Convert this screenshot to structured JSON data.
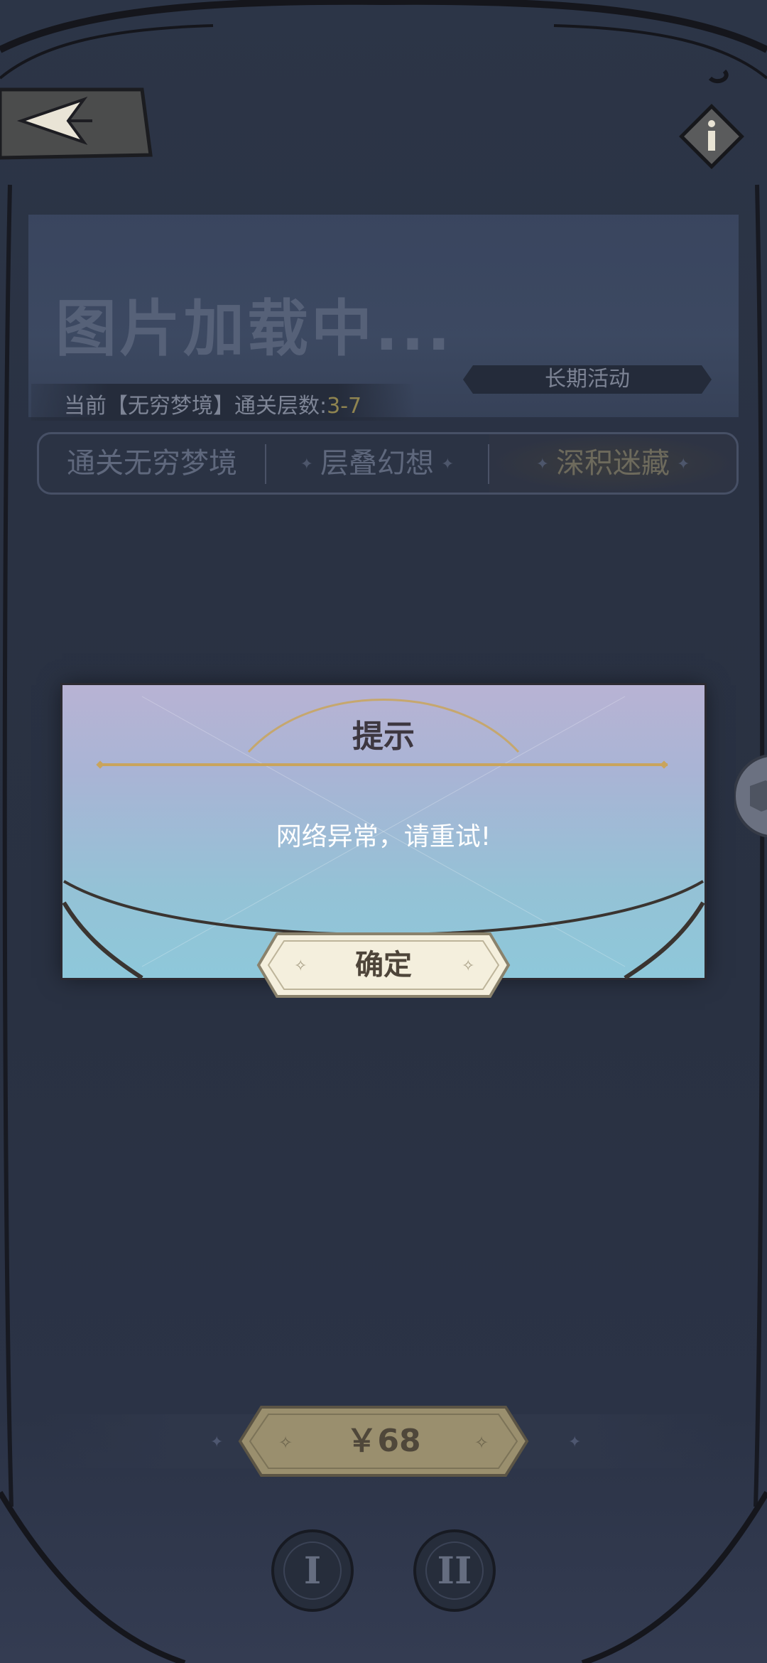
{
  "banner": {
    "title": "图片加载中...",
    "tag": "长期活动",
    "progress_label": "当前【无穷梦境】通关层数:",
    "progress_value": "3-7"
  },
  "tabs": [
    {
      "label": "通关无穷梦境",
      "active": false
    },
    {
      "label": "层叠幻想",
      "active": false
    },
    {
      "label": "深积迷藏",
      "active": true
    }
  ],
  "dialog": {
    "title": "提示",
    "message": "网络异常，请重试!",
    "confirm_label": "确定"
  },
  "purchase": {
    "price": "￥68"
  },
  "bottom_nav": [
    {
      "label": "I"
    },
    {
      "label": "II"
    }
  ],
  "icons": {
    "back": "back-arrow-icon",
    "info": "info-icon",
    "side": "box-icon"
  },
  "colors": {
    "background": "#2a3243",
    "dialog_top": "#b8b3d4",
    "dialog_bottom": "#8ec8da",
    "gold": "#c9a45c"
  }
}
